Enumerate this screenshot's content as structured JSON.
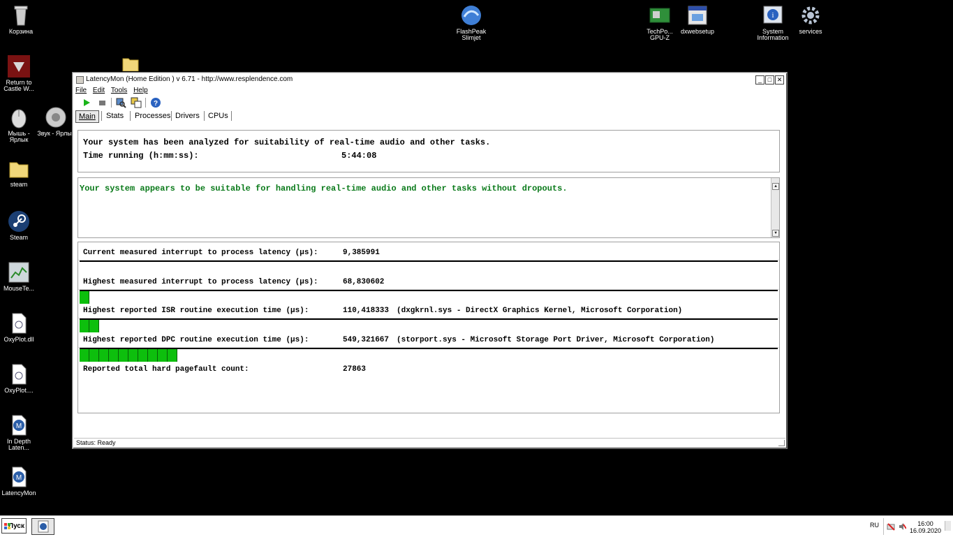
{
  "desktop": {
    "icons": [
      {
        "label": "Корзина",
        "icon": "recycle-bin-icon"
      },
      {
        "label": "Return to Castle W...",
        "icon": "game-shortcut-icon"
      },
      {
        "label": "Мышь - Ярлык",
        "icon": "mouse-shortcut-icon"
      },
      {
        "label": "Звук - Ярлык",
        "icon": "speaker-shortcut-icon"
      },
      {
        "label": "steam",
        "icon": "folder-icon"
      },
      {
        "label": "Steam",
        "icon": "steam-icon"
      },
      {
        "label": "MouseTe...",
        "icon": "app-icon"
      },
      {
        "label": "OxyPlot.dll",
        "icon": "dll-file-icon"
      },
      {
        "label": "OxyPlot....",
        "icon": "dll-file-icon"
      },
      {
        "label": "In Depth Laten...",
        "icon": "latencymon-icon"
      },
      {
        "label": "LatencyMon",
        "icon": "latencymon-icon"
      },
      {
        "label": "FlashPeak Slimjet",
        "icon": "browser-icon"
      },
      {
        "label": "TechPo... GPU-Z",
        "icon": "gpu-z-icon"
      },
      {
        "label": "dxwebsetup",
        "icon": "installer-icon"
      },
      {
        "label": "System Information",
        "icon": "system-information-icon"
      },
      {
        "label": "services",
        "icon": "gear-icon"
      }
    ]
  },
  "window": {
    "title": "LatencyMon  (Home Edition )  v 6.71 - http://www.resplendence.com",
    "controls": [
      "_",
      "□",
      "✕"
    ],
    "menu": [
      "File",
      "Edit",
      "Tools",
      "Help"
    ],
    "toolbar": [
      "play-icon",
      "stop-icon",
      "scan-icon",
      "copy-icon",
      "help-icon"
    ],
    "tabs": [
      "Main",
      "Stats",
      "Processes",
      "Drivers",
      "CPUs"
    ],
    "active_tab": "Main",
    "status": "Status: Ready"
  },
  "summary": {
    "line1": "Your system has been analyzed for suitability of real-time audio and other tasks.",
    "time_label": "Time running (h:mm:ss):",
    "time_value": "5:44:08"
  },
  "verdict": {
    "message": "Your system appears to be suitable for handling real-time audio and other tasks without dropouts.",
    "color": "#0a7a1a"
  },
  "metrics": [
    {
      "label": "Current measured interrupt to process latency (µs):",
      "value": "9,385991",
      "source": "",
      "bar_segments": 0
    },
    {
      "label": "Highest measured interrupt to process latency (µs):",
      "value": "68,830602",
      "source": "",
      "bar_segments": 1
    },
    {
      "label": "Highest reported ISR routine execution time (µs):",
      "value": "110,418333",
      "source": "(dxgkrnl.sys - DirectX Graphics Kernel, Microsoft Corporation)",
      "bar_segments": 2
    },
    {
      "label": "Highest reported DPC routine execution time (µs):",
      "value": "549,321667",
      "source": "(storport.sys - Microsoft Storage Port Driver, Microsoft Corporation)",
      "bar_segments": 10
    },
    {
      "label": "Reported total hard pagefault count:",
      "value": "27863",
      "source": "",
      "bar_segments": null
    }
  ],
  "bar_color": "#0dbf0d",
  "taskbar": {
    "start_label": "Пуск",
    "language": "RU",
    "time": "16:00",
    "date": "16.09.2020"
  }
}
